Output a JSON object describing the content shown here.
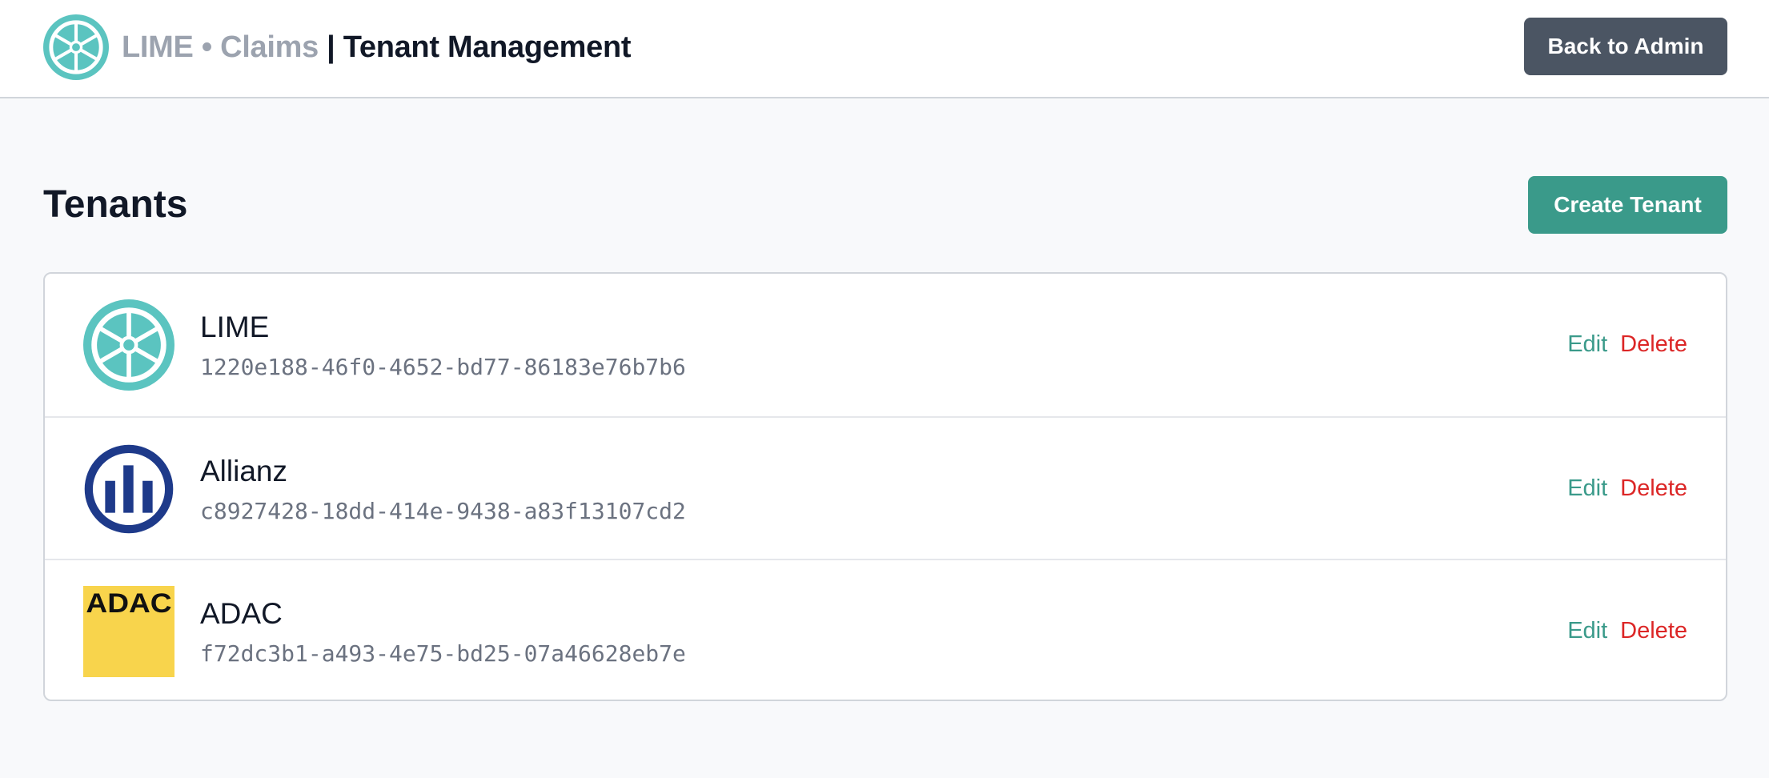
{
  "header": {
    "brand_primary": "LIME • Claims",
    "brand_separator": " | ",
    "brand_title": "Tenant Management",
    "back_button": "Back to Admin"
  },
  "main": {
    "title": "Tenants",
    "create_button": "Create Tenant"
  },
  "tenants": [
    {
      "name": "LIME",
      "id": "1220e188-46f0-4652-bd77-86183e76b7b6",
      "logo": "lime-wheel-logo",
      "edit": "Edit",
      "delete": "Delete"
    },
    {
      "name": "Allianz",
      "id": "c8927428-18dd-414e-9438-a83f13107cd2",
      "logo": "allianz-logo",
      "edit": "Edit",
      "delete": "Delete"
    },
    {
      "name": "ADAC",
      "id": "f72dc3b1-a493-4e75-bd25-07a46628eb7e",
      "logo": "adac-logo",
      "logo_text": "ADAC",
      "edit": "Edit",
      "delete": "Delete"
    }
  ],
  "colors": {
    "accent": "#3a9a8a",
    "danger": "#dc2626",
    "back_button": "#4b5563",
    "lime_logo": "#5bc4c0",
    "allianz_blue": "#1e3a8a",
    "adac_yellow": "#f8d44c"
  }
}
